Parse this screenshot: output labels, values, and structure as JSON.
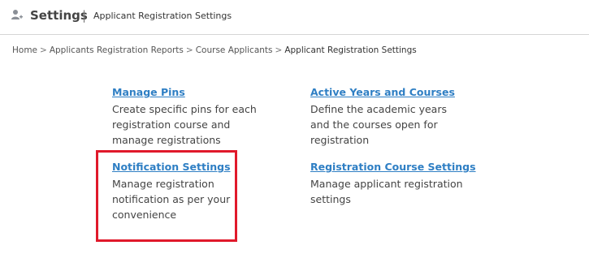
{
  "header": {
    "icon": "user-add-icon",
    "title": "Settings",
    "separator": "|",
    "subtitle": "Applicant Registration Settings"
  },
  "breadcrumb": {
    "items": [
      "Home",
      "Applicants Registration Reports",
      "Course Applicants",
      "Applicant Registration Settings"
    ],
    "separator": ">"
  },
  "cards": [
    {
      "title": "Manage Pins",
      "description": "Create specific pins for each registration course and manage registrations"
    },
    {
      "title": "Active Years and Courses",
      "description": "Define the academic years and the courses open for registration"
    },
    {
      "title": "Notification Settings",
      "description": "Manage registration notification as per your convenience"
    },
    {
      "title": "Registration Course Settings",
      "description": "Manage applicant registration settings"
    }
  ],
  "colors": {
    "link": "#2f7fc4",
    "highlight": "#e0192b",
    "text": "#444444"
  }
}
